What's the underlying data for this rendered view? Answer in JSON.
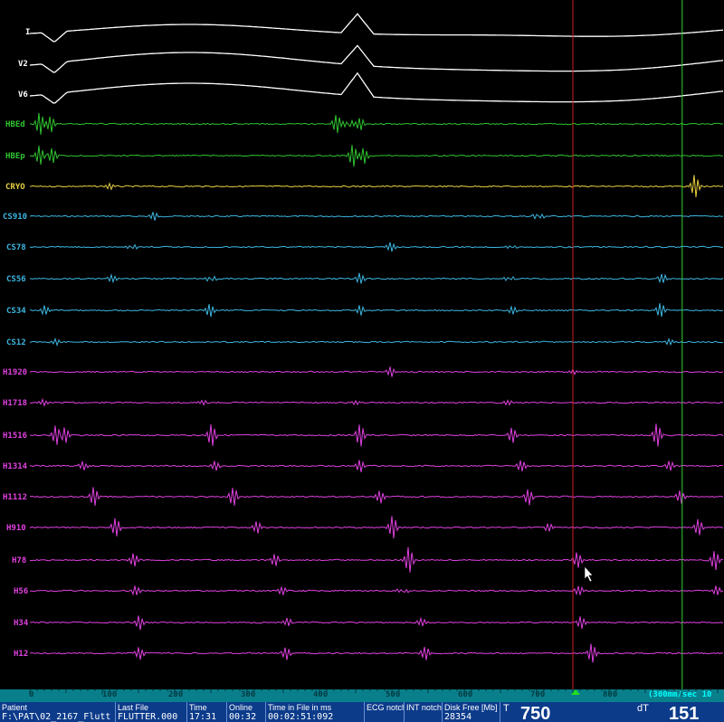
{
  "channels": [
    {
      "label": "I",
      "color": "#ffffff"
    },
    {
      "label": "V2",
      "color": "#ffffff"
    },
    {
      "label": "V6",
      "color": "#ffffff"
    },
    {
      "label": "HBEd",
      "color": "#2fc42f"
    },
    {
      "label": "HBEp",
      "color": "#2fc42f"
    },
    {
      "label": "CRYO",
      "color": "#e8d040"
    },
    {
      "label": "CS910",
      "color": "#3cb6e0"
    },
    {
      "label": "CS78",
      "color": "#3cb6e0"
    },
    {
      "label": "CS56",
      "color": "#3cb6e0"
    },
    {
      "label": "CS34",
      "color": "#3cb6e0"
    },
    {
      "label": "CS12",
      "color": "#3cb6e0"
    },
    {
      "label": "H1920",
      "color": "#e040e0"
    },
    {
      "label": "H1718",
      "color": "#e040e0"
    },
    {
      "label": "H1516",
      "color": "#e040e0"
    },
    {
      "label": "H1314",
      "color": "#e040e0"
    },
    {
      "label": "H1112",
      "color": "#e040e0"
    },
    {
      "label": "H910",
      "color": "#e040e0"
    },
    {
      "label": "H78",
      "color": "#e040e0"
    },
    {
      "label": "H56",
      "color": "#e040e0"
    },
    {
      "label": "H34",
      "color": "#e040e0"
    },
    {
      "label": "H12",
      "color": "#e040e0"
    }
  ],
  "timeline": {
    "ticks": [
      "0",
      "100",
      "200",
      "300",
      "400",
      "500",
      "600",
      "700",
      "800"
    ],
    "speed": "(300mm/sec 10",
    "calipers": [
      {
        "name": "red-caliper",
        "ms": 750,
        "color": "#d02020"
      },
      {
        "name": "green-caliper",
        "ms": 901,
        "color": "#30d030"
      }
    ]
  },
  "status": {
    "patient_label": "Patient",
    "patient_value": "F:\\PAT\\02_2167_Flutt",
    "lastfile_label": "Last File",
    "lastfile_value": "FLUTTER.000",
    "time_label": "Time",
    "time_value": "17:31",
    "online_label": "Online",
    "online_value": "00:32",
    "timeinfile_label": "Time in File in ms",
    "timeinfile_value": "00:02:51:092",
    "ecgnotch_label": "ECG notch",
    "intnotch_label": "INT notch",
    "diskfree_label": "Disk Free [Mb]",
    "diskfree_value": "28354",
    "t_label": "T",
    "t_value": "750",
    "dt_label": "dT",
    "dt_value": "151"
  },
  "colors": {
    "timebar": "#0a7f8c",
    "statusbar": "#0c3b8a",
    "caliper_marker": "#20e020"
  }
}
